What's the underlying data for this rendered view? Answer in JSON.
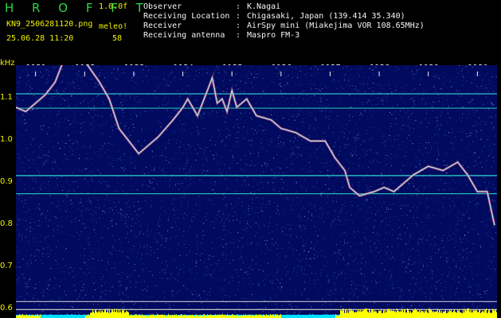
{
  "header": {
    "app_name": "H R O F F T",
    "version": "1.0.0f",
    "filename": "KN9_2506281120.png",
    "meleo_label": "meleo!",
    "datetime": "25.06.28 11:20",
    "count": "58"
  },
  "info": [
    {
      "key": "Observer",
      "value": "K.Nagai"
    },
    {
      "key": "Receiving Location",
      "value": "Chigasaki, Japan (139.414 35.340)"
    },
    {
      "key": "Receiver",
      "value": "AirSpy mini (Miakejima VOR 108.65MHz)"
    },
    {
      "key": "Receiving antenna",
      "value": "Maspro FM-3"
    }
  ],
  "chart_data": {
    "type": "heatmap",
    "ylabel": "kHz",
    "y_ticks": [
      "1.1",
      "1.0",
      "0.9",
      "0.8",
      "0.7",
      "0.6"
    ],
    "x_ticks": [
      "1121",
      "1122",
      "1123",
      "1124",
      "1125",
      "1126",
      "1127",
      "1128",
      "1129",
      "1130"
    ],
    "ylim": [
      0.58,
      1.18
    ],
    "xlim": [
      1120.6,
      1130.4
    ],
    "trace": [
      [
        1120.6,
        1.08
      ],
      [
        1120.8,
        1.07
      ],
      [
        1121.0,
        1.09
      ],
      [
        1121.2,
        1.11
      ],
      [
        1121.4,
        1.14
      ],
      [
        1121.6,
        1.2
      ],
      [
        1122.0,
        1.19
      ],
      [
        1122.3,
        1.14
      ],
      [
        1122.5,
        1.1
      ],
      [
        1122.7,
        1.03
      ],
      [
        1122.9,
        1.0
      ],
      [
        1123.1,
        0.97
      ],
      [
        1123.3,
        0.99
      ],
      [
        1123.5,
        1.01
      ],
      [
        1123.8,
        1.05
      ],
      [
        1124.0,
        1.08
      ],
      [
        1124.1,
        1.1
      ],
      [
        1124.3,
        1.06
      ],
      [
        1124.5,
        1.12
      ],
      [
        1124.6,
        1.15
      ],
      [
        1124.7,
        1.09
      ],
      [
        1124.8,
        1.1
      ],
      [
        1124.9,
        1.07
      ],
      [
        1125.0,
        1.12
      ],
      [
        1125.1,
        1.08
      ],
      [
        1125.3,
        1.1
      ],
      [
        1125.5,
        1.06
      ],
      [
        1125.8,
        1.05
      ],
      [
        1126.0,
        1.03
      ],
      [
        1126.3,
        1.02
      ],
      [
        1126.6,
        1.0
      ],
      [
        1126.9,
        1.0
      ],
      [
        1127.1,
        0.96
      ],
      [
        1127.3,
        0.93
      ],
      [
        1127.4,
        0.89
      ],
      [
        1127.6,
        0.87
      ],
      [
        1127.9,
        0.88
      ],
      [
        1128.1,
        0.89
      ],
      [
        1128.3,
        0.88
      ],
      [
        1128.5,
        0.9
      ],
      [
        1128.7,
        0.92
      ],
      [
        1129.0,
        0.94
      ],
      [
        1129.3,
        0.93
      ],
      [
        1129.6,
        0.95
      ],
      [
        1129.8,
        0.92
      ],
      [
        1130.0,
        0.88
      ],
      [
        1130.2,
        0.88
      ],
      [
        1130.35,
        0.8
      ]
    ],
    "carriers": [
      {
        "y": 1.112,
        "color": "#2fd8d0"
      },
      {
        "y": 1.078,
        "color": "#22b8b0"
      },
      {
        "y": 0.918,
        "color": "#2fd8d0"
      },
      {
        "y": 0.875,
        "color": "#22b8b0"
      },
      {
        "y": 0.619,
        "color": "#c0c0c0"
      },
      {
        "y": 0.6,
        "color": "#c0c0c0"
      }
    ],
    "noise_color": "#1a2a8a",
    "background_color": "#000a5e",
    "level_bar_color": "#ffff00",
    "level_bar_alt_color": "#00e0ff"
  }
}
